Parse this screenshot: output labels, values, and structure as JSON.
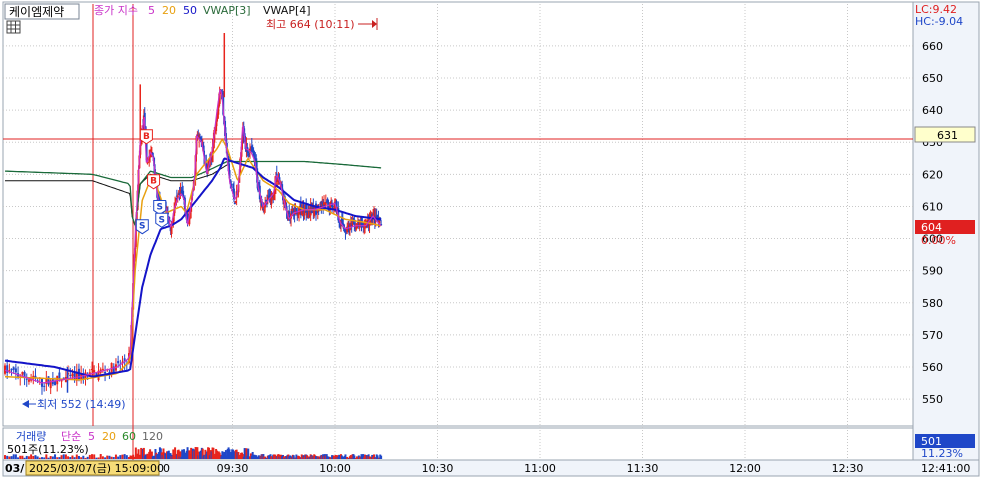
{
  "header": {
    "symbol": "케이엠제약",
    "indicator_label": "종가 지수",
    "ma_periods": [
      "5",
      "20",
      "50"
    ],
    "vwap3": "VWAP[3]",
    "vwap4": "VWAP[4]"
  },
  "annotations": {
    "high": "최고 664 (10:11)",
    "low": "최저 552 (14:49)",
    "buy_marker": "B",
    "sell_marker": "S"
  },
  "right_axis": {
    "lc": "LC:9.42",
    "hc": "HC:-9.04",
    "h_line_value": "631",
    "current_price": "604",
    "current_change": "0.00%"
  },
  "volume_panel": {
    "title": "거래량",
    "ma_label": "단순",
    "ma_periods": [
      "5",
      "20",
      "60",
      "120"
    ],
    "current_volume": "501주(11.23%)",
    "axis_value": "501",
    "axis_pct": "11.23%"
  },
  "time_axis": {
    "left_stub": "03/",
    "cursor_label": "2025/03/07(금) 15:09:00",
    "zero": "0",
    "current_time": "12:41:00"
  },
  "colors": {
    "grid": "#c8c8c8",
    "up": "#e8241c",
    "down": "#1f47c8",
    "ma5": "#c832c8",
    "ma20": "#e8a010",
    "ma50": "#1414c8",
    "vwap3": "#111111",
    "vwap4": "#1a6a3a",
    "hline": "#e02020",
    "axis_panel": "#f0f4fa"
  },
  "chart_data": {
    "type": "candlestick",
    "x_ticks": [
      "09:30",
      "10:00",
      "10:30",
      "11:00",
      "11:30",
      "12:00",
      "12:30"
    ],
    "y_ticks": [
      550,
      560,
      570,
      580,
      590,
      600,
      610,
      620,
      630,
      640,
      650,
      660
    ],
    "ylim": [
      546,
      664
    ],
    "h_line": 631,
    "high": {
      "value": 664,
      "time": "10:11"
    },
    "low": {
      "value": 552,
      "time": "14:49"
    },
    "keypoints": [
      [
        0,
        559
      ],
      [
        0.15,
        555
      ],
      [
        0.3,
        557
      ],
      [
        0.45,
        560
      ],
      [
        0.5,
        563
      ],
      [
        0.55,
        600
      ],
      [
        0.6,
        630
      ],
      [
        0.64,
        638
      ],
      [
        0.66,
        623
      ],
      [
        0.7,
        627
      ],
      [
        0.73,
        625
      ],
      [
        0.76,
        615
      ],
      [
        0.8,
        607
      ],
      [
        0.85,
        610
      ],
      [
        0.9,
        603
      ],
      [
        0.93,
        609
      ],
      [
        0.96,
        612
      ],
      [
        1.0,
        614
      ],
      [
        1.03,
        612
      ],
      [
        1.06,
        604
      ],
      [
        1.1,
        611
      ],
      [
        1.13,
        619
      ],
      [
        1.15,
        632
      ],
      [
        1.2,
        630
      ],
      [
        1.25,
        620
      ],
      [
        1.3,
        627
      ],
      [
        1.35,
        640
      ],
      [
        1.38,
        647
      ],
      [
        1.4,
        644
      ],
      [
        1.43,
        632
      ],
      [
        1.47,
        618
      ],
      [
        1.52,
        612
      ],
      [
        1.55,
        614
      ],
      [
        1.58,
        625
      ],
      [
        1.6,
        636
      ],
      [
        1.63,
        628
      ],
      [
        1.68,
        627
      ],
      [
        1.72,
        624
      ],
      [
        1.75,
        616
      ],
      [
        1.8,
        610
      ],
      [
        1.85,
        612
      ],
      [
        1.9,
        614
      ],
      [
        1.93,
        620
      ],
      [
        1.97,
        617
      ],
      [
        2.0,
        612
      ],
      [
        2.05,
        606
      ],
      [
        2.1,
        608
      ],
      [
        2.2,
        609
      ],
      [
        2.3,
        609
      ],
      [
        2.4,
        610
      ],
      [
        2.5,
        611
      ],
      [
        2.55,
        605
      ],
      [
        2.6,
        603
      ],
      [
        2.7,
        604
      ],
      [
        2.8,
        604
      ],
      [
        2.87,
        607
      ],
      [
        2.92,
        605
      ],
      [
        2.95,
        604
      ]
    ],
    "ma20_keypoints": [
      [
        0,
        557
      ],
      [
        0.3,
        556
      ],
      [
        0.45,
        558
      ],
      [
        0.5,
        562
      ],
      [
        0.55,
        590
      ],
      [
        0.62,
        612
      ],
      [
        0.72,
        620
      ],
      [
        0.85,
        608
      ],
      [
        1.0,
        610
      ],
      [
        1.05,
        608
      ],
      [
        1.15,
        620
      ],
      [
        1.25,
        624
      ],
      [
        1.35,
        628
      ],
      [
        1.4,
        631
      ],
      [
        1.45,
        628
      ],
      [
        1.55,
        618
      ],
      [
        1.65,
        625
      ],
      [
        1.8,
        618
      ],
      [
        1.95,
        615
      ],
      [
        2.05,
        611
      ],
      [
        2.2,
        609
      ],
      [
        2.4,
        609
      ],
      [
        2.6,
        606
      ],
      [
        2.8,
        605
      ],
      [
        2.95,
        604
      ]
    ],
    "ma50_keypoints": [
      [
        0,
        562
      ],
      [
        0.2,
        560
      ],
      [
        0.35,
        557
      ],
      [
        0.5,
        559
      ],
      [
        0.55,
        570
      ],
      [
        0.62,
        585
      ],
      [
        0.7,
        595
      ],
      [
        0.8,
        603
      ],
      [
        0.9,
        604
      ],
      [
        1.0,
        606
      ],
      [
        1.1,
        610
      ],
      [
        1.2,
        614
      ],
      [
        1.3,
        618
      ],
      [
        1.38,
        622
      ],
      [
        1.42,
        625
      ],
      [
        1.5,
        624
      ],
      [
        1.6,
        623
      ],
      [
        1.7,
        622
      ],
      [
        1.8,
        619
      ],
      [
        1.95,
        616
      ],
      [
        2.1,
        612
      ],
      [
        2.3,
        610
      ],
      [
        2.5,
        609
      ],
      [
        2.7,
        607
      ],
      [
        2.95,
        606
      ]
    ],
    "vwap4_keypoints": [
      [
        0,
        621
      ],
      [
        0.35,
        620
      ],
      [
        0.5,
        617
      ],
      [
        0.52,
        607
      ],
      [
        0.55,
        604
      ],
      [
        0.6,
        617
      ],
      [
        0.7,
        621
      ],
      [
        0.9,
        619
      ],
      [
        1.1,
        619
      ],
      [
        1.25,
        621
      ],
      [
        1.38,
        623
      ],
      [
        1.45,
        624
      ],
      [
        1.6,
        624
      ],
      [
        1.8,
        624
      ],
      [
        2.2,
        624
      ],
      [
        2.6,
        623
      ],
      [
        2.95,
        622
      ]
    ],
    "vwap3_keypoints": [
      [
        0,
        618
      ],
      [
        0.35,
        618
      ],
      [
        0.5,
        614
      ],
      [
        0.52,
        607
      ],
      [
        0.55,
        604
      ],
      [
        0.6,
        617
      ],
      [
        0.7,
        620
      ],
      [
        0.9,
        618
      ],
      [
        1.1,
        618
      ],
      [
        1.3,
        620
      ],
      [
        1.45,
        623
      ]
    ]
  }
}
